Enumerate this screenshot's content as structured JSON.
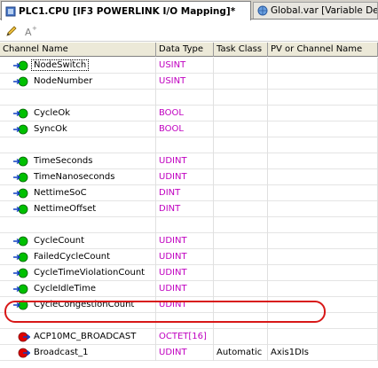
{
  "tabs": [
    {
      "label": "PLC1.CPU [IF3 POWERLINK I/O Mapping]*",
      "active": true
    },
    {
      "label": "Global.var [Variable Declaration]",
      "active": false
    }
  ],
  "toolbar": {
    "icons": [
      "edit-icon",
      "sort-icon"
    ]
  },
  "columns": [
    "Channel Name",
    "Data Type",
    "Task Class",
    "PV or Channel Name"
  ],
  "rows": [
    {
      "name": "NodeSwitch",
      "type": "USINT",
      "task": "",
      "pv": "",
      "icon": "green-input",
      "selected": true
    },
    {
      "name": "NodeNumber",
      "type": "USINT",
      "task": "",
      "pv": "",
      "icon": "green-input"
    },
    {
      "name": "",
      "type": "",
      "task": "",
      "pv": "",
      "icon": ""
    },
    {
      "name": "CycleOk",
      "type": "BOOL",
      "task": "",
      "pv": "",
      "icon": "green-input"
    },
    {
      "name": "SyncOk",
      "type": "BOOL",
      "task": "",
      "pv": "",
      "icon": "green-input"
    },
    {
      "name": "",
      "type": "",
      "task": "",
      "pv": "",
      "icon": ""
    },
    {
      "name": "TimeSeconds",
      "type": "UDINT",
      "task": "",
      "pv": "",
      "icon": "green-input"
    },
    {
      "name": "TimeNanoseconds",
      "type": "UDINT",
      "task": "",
      "pv": "",
      "icon": "green-input"
    },
    {
      "name": "NettimeSoC",
      "type": "DINT",
      "task": "",
      "pv": "",
      "icon": "green-input"
    },
    {
      "name": "NettimeOffset",
      "type": "DINT",
      "task": "",
      "pv": "",
      "icon": "green-input"
    },
    {
      "name": "",
      "type": "",
      "task": "",
      "pv": "",
      "icon": ""
    },
    {
      "name": "CycleCount",
      "type": "UDINT",
      "task": "",
      "pv": "",
      "icon": "green-input"
    },
    {
      "name": "FailedCycleCount",
      "type": "UDINT",
      "task": "",
      "pv": "",
      "icon": "green-input"
    },
    {
      "name": "CycleTimeViolationCount",
      "type": "UDINT",
      "task": "",
      "pv": "",
      "icon": "green-input"
    },
    {
      "name": "CycleIdleTime",
      "type": "UDINT",
      "task": "",
      "pv": "",
      "icon": "green-input"
    },
    {
      "name": "CycleCongestionCount",
      "type": "UDINT",
      "task": "",
      "pv": "",
      "icon": "green-input"
    },
    {
      "name": "",
      "type": "",
      "task": "",
      "pv": "",
      "icon": ""
    },
    {
      "name": "ACP10MC_BROADCAST",
      "type": "OCTET[16]",
      "task": "",
      "pv": "",
      "icon": "red-output"
    },
    {
      "name": "Broadcast_1",
      "type": "UDINT",
      "task": "Automatic",
      "pv": "Axis1DIs",
      "icon": "red-output",
      "highlighted": true
    }
  ],
  "colors": {
    "type_text": "#c000c0",
    "input_icon": "#00c000",
    "output_icon": "#e00000",
    "highlight": "#d81818"
  }
}
